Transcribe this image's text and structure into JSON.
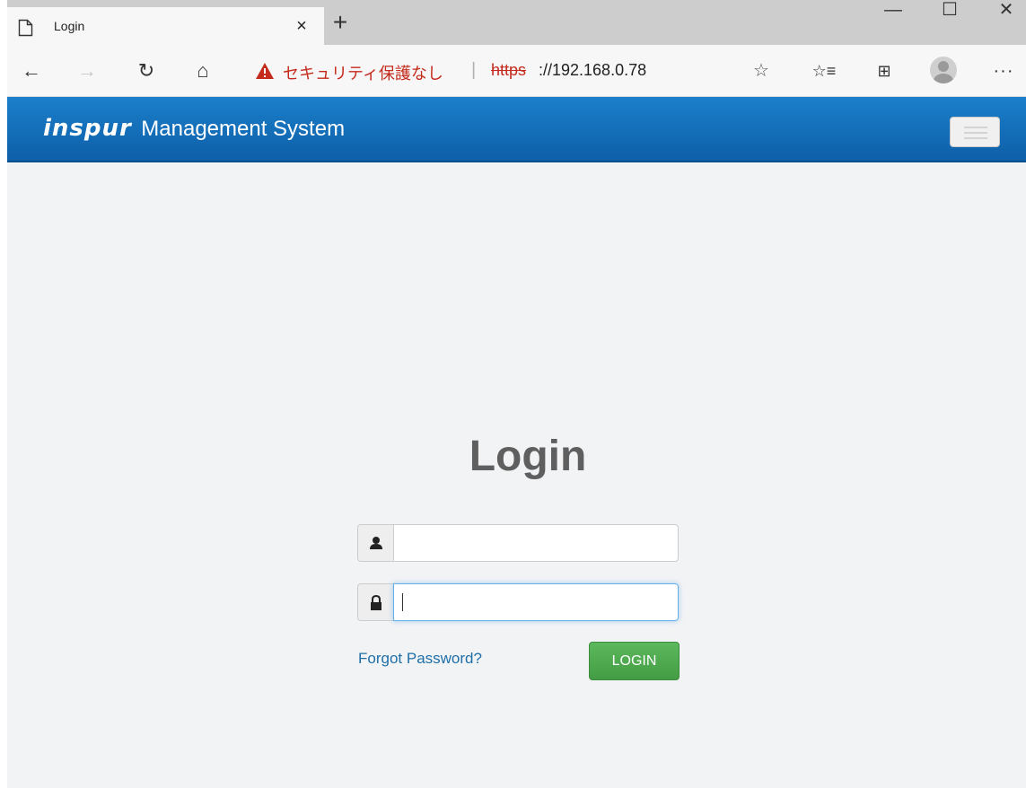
{
  "browser": {
    "tab": {
      "title": "Login",
      "close_label": "×",
      "page_icon": "page-icon"
    },
    "new_tab_label": "+",
    "window_controls": {
      "minimize": "—",
      "maximize": "☐",
      "close": "✕"
    },
    "toolbar": {
      "back_icon": "←",
      "forward_icon": "→",
      "refresh_icon": "↻",
      "home_icon": "⌂",
      "favorite_icon": "☆",
      "favorites_icon": "☆≡",
      "collections_icon": "⊞",
      "more_icon": "···"
    },
    "address_bar": {
      "warning_text": "セキュリティ保護なし",
      "separator": "|",
      "url_scheme": "https",
      "url_rest": "://192.168.0.78",
      "warning_color": "#c42b1c"
    }
  },
  "app": {
    "logo_text": "inspur",
    "title": "Management System",
    "header_color": "#1570bd"
  },
  "login": {
    "heading": "Login",
    "username": {
      "value": "",
      "icon": "user-icon"
    },
    "password": {
      "value": "",
      "icon": "lock-icon"
    },
    "forgot_link": "Forgot Password?",
    "submit_label": "LOGIN",
    "button_color": "#4cae4c"
  }
}
